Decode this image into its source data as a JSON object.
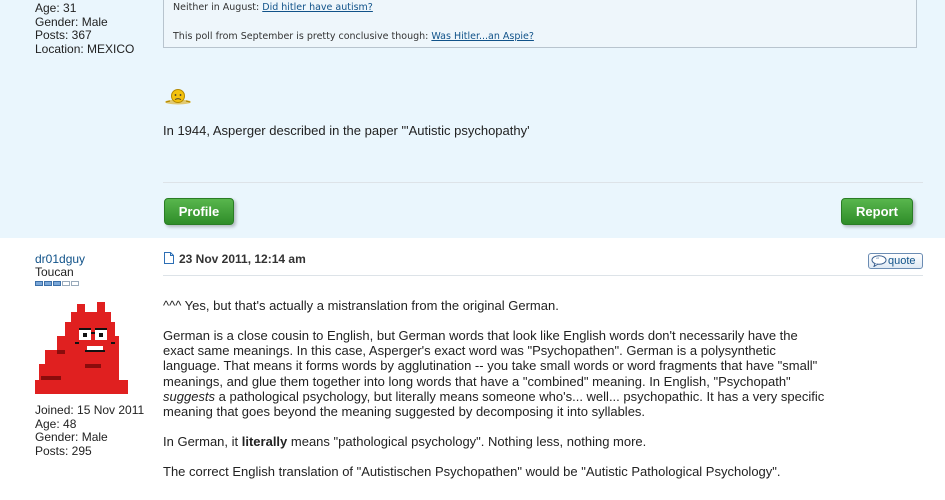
{
  "post1": {
    "author_stats": [
      "Age: 31",
      "Gender: Male",
      "Posts: 367",
      "Location: MEXICO"
    ],
    "quote": {
      "line1_text": "Neither in August: ",
      "line1_link": "Did hitler have autism?",
      "line2_text": "This poll from September is pretty conclusive though: ",
      "line2_link": "Was Hitler...an Aspie?"
    },
    "smiley": "sad-smiley-icon",
    "body": "In 1944, Asperger described in the paper \"'Autistic psychopathy'",
    "profile_label": "Profile",
    "report_label": "Report"
  },
  "post2": {
    "username": "dr01dguy",
    "rank": "Toucan",
    "rank_level": 0.6,
    "author_stats": [
      "Joined: 15 Nov 2011",
      "Age: 48",
      "Gender: Male",
      "Posts: 295"
    ],
    "date": "23 Nov 2011, 12:14 am",
    "quote_label": "quote",
    "p1": "^^^ Yes, but that's actually a mistranslation from the original German.",
    "p2_lines": [
      "German is a close cousin to English, but German words that look like English words don't necessarily have the",
      "exact same meanings. In this case, Asperger's exact word was \"Psychopathen\". German is a polysynthetic",
      "language. That means it forms words by agglutination -- you take small words or word fragments that have \"small\"",
      "meanings, and glue them together into long words that have a \"combined\" meaning. In English, \"Psychopath\""
    ],
    "p2_em": "suggests",
    "p2_line5_rest": " a pathological psychology, but literally means someone who's... well... psychopathic. It has a very specific",
    "p2_line6": "meaning that goes beyond the meaning suggested by decomposing it into syllables.",
    "p3_a": "In German, it ",
    "p3_bold": "literally",
    "p3_b": " means \"pathological psychology\". Nothing less, nothing more.",
    "p4": "The correct English translation of \"Autistischen Psychopathen\" would be \"Autistic Pathological Psychology\"."
  },
  "colors": {
    "post1_bg": "#eaf6fd",
    "link": "#105289",
    "button_green": "#3a9a33"
  }
}
